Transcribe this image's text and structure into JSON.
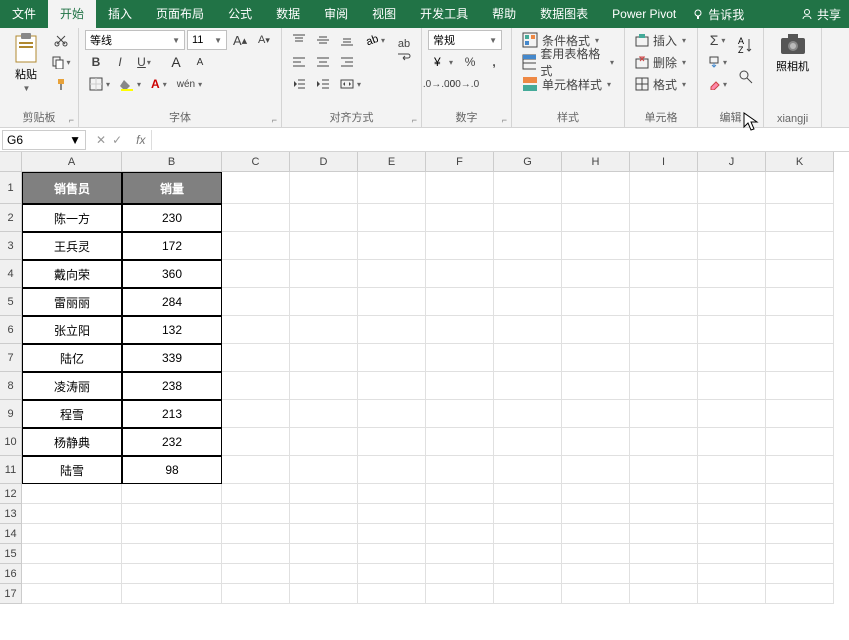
{
  "tabs": [
    "文件",
    "开始",
    "插入",
    "页面布局",
    "公式",
    "数据",
    "审阅",
    "视图",
    "开发工具",
    "帮助",
    "数据图表",
    "Power Pivot"
  ],
  "tell_me": "告诉我",
  "share": "共享",
  "ribbon": {
    "clipboard": {
      "paste": "粘贴",
      "label": "剪贴板"
    },
    "font": {
      "name": "等线",
      "size": "11",
      "label": "字体"
    },
    "align": {
      "wrap": "ab",
      "label": "对齐方式"
    },
    "number": {
      "general": "常规",
      "label": "数字"
    },
    "styles": {
      "cond": "条件格式",
      "table": "套用表格格式",
      "cell": "单元格样式",
      "label": "样式"
    },
    "cells": {
      "insert": "插入",
      "delete": "删除",
      "format": "格式",
      "label": "单元格"
    },
    "editing": {
      "label": "编辑"
    },
    "camera": {
      "label": "照相机",
      "group": "xiangji"
    }
  },
  "name_box": "G6",
  "columns": [
    "A",
    "B",
    "C",
    "D",
    "E",
    "F",
    "G",
    "H",
    "I",
    "J",
    "K"
  ],
  "headers": {
    "a": "销售员",
    "b": "销量"
  },
  "rows": [
    {
      "a": "陈一方",
      "b": "230"
    },
    {
      "a": "王兵灵",
      "b": "172"
    },
    {
      "a": "戴向荣",
      "b": "360"
    },
    {
      "a": "雷丽丽",
      "b": "284"
    },
    {
      "a": "张立阳",
      "b": "132"
    },
    {
      "a": "陆亿",
      "b": "339"
    },
    {
      "a": "凌涛丽",
      "b": "238"
    },
    {
      "a": "程雪",
      "b": "213"
    },
    {
      "a": "杨静典",
      "b": "232"
    },
    {
      "a": "陆雪",
      "b": "98"
    }
  ],
  "row_nums": [
    "1",
    "2",
    "3",
    "4",
    "5",
    "6",
    "7",
    "8",
    "9",
    "10",
    "11",
    "12",
    "13",
    "14",
    "15",
    "16",
    "17"
  ]
}
